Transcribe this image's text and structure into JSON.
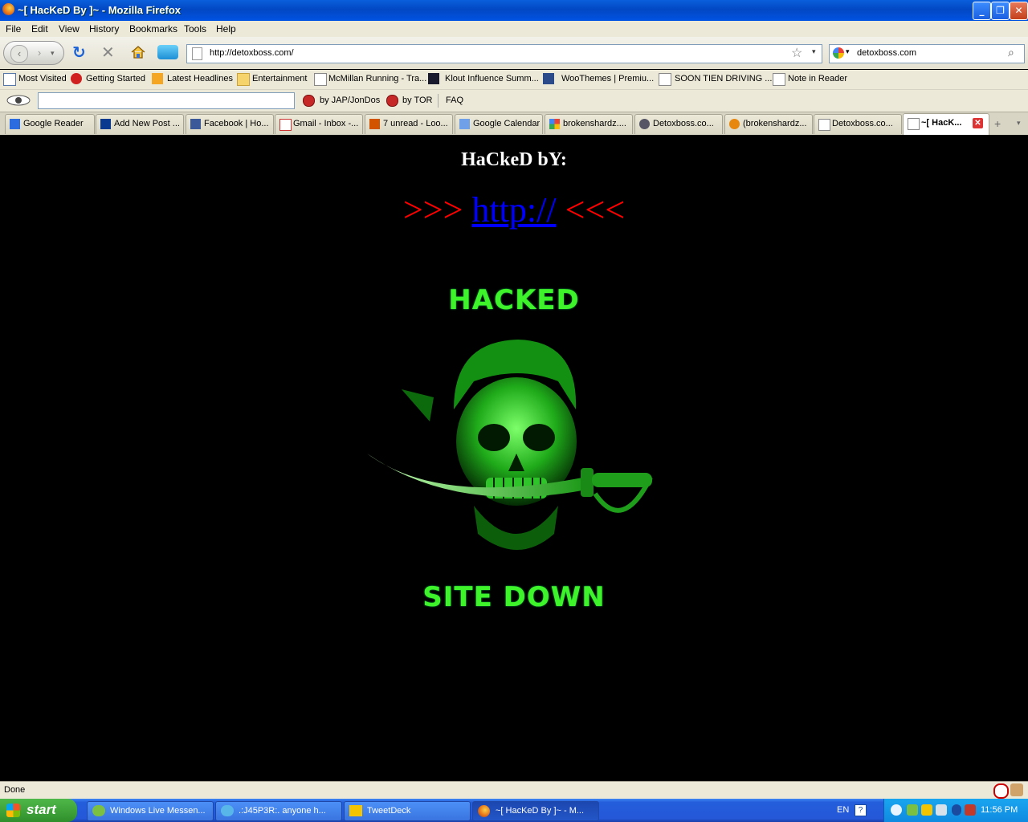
{
  "window": {
    "title": "~[ HacKeD By ]~ - Mozilla Firefox",
    "minimize": "_",
    "restore": "❐",
    "close": "✕"
  },
  "menu": [
    "File",
    "Edit",
    "View",
    "History",
    "Bookmarks",
    "Tools",
    "Help"
  ],
  "nav": {
    "url": "http://detoxboss.com/",
    "search_value": "detoxboss.com"
  },
  "bookmarks": [
    "Most Visited",
    "Getting Started",
    "Latest Headlines",
    "Entertainment",
    "McMillan Running - Tra...",
    "Klout Influence Summ...",
    "WooThemes | Premiu...",
    "SOON TIEN DRIVING ...",
    "Note in Reader"
  ],
  "addon_bar": {
    "item1": "by JAP/JonDos",
    "item2": "by TOR",
    "faq": "FAQ"
  },
  "tabs": [
    "Google Reader",
    "Add New Post ...",
    "Facebook | Ho...",
    "Gmail - Inbox -...",
    "7 unread - Loo...",
    "Google Calendar",
    "brokenshardz....",
    "Detoxboss.co...",
    "(brokenshardz...",
    "Detoxboss.co...",
    "~[ HacK..."
  ],
  "page": {
    "heading": "HaCkeD bY:",
    "arrows_left": ">>>",
    "link": "http://",
    "arrows_right": "<<<",
    "hacked_text": "HACKED",
    "site_down_text": "SITE DOWN"
  },
  "status": {
    "text": "Done"
  },
  "taskbar": {
    "start": "start",
    "tasks": [
      "Windows Live Messen...",
      ".:J45P3R:. anyone h...",
      "TweetDeck",
      "~[ HacKeD By ]~ - M..."
    ],
    "lang": "EN",
    "clock": "11:56 PM"
  },
  "colors": {
    "page_background": "#000000",
    "arrows": "#ff0000",
    "link": "#0000ff",
    "skull_green": "#3ef32a"
  }
}
